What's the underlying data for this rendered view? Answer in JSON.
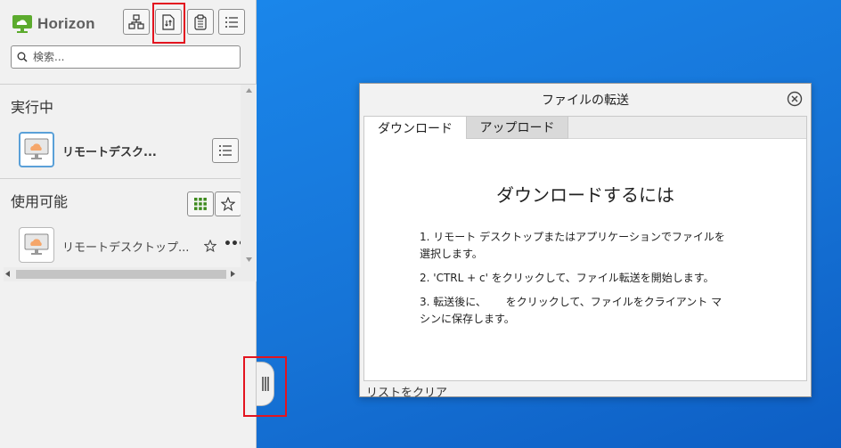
{
  "app": {
    "name": "Horizon"
  },
  "search": {
    "placeholder": "検索..."
  },
  "sections": {
    "running": {
      "title": "実行中",
      "item_label": "リモートデスク..."
    },
    "available": {
      "title": "使用可能",
      "item_label": "リモートデスクトップ..."
    }
  },
  "dialog": {
    "title": "ファイルの転送",
    "tabs": [
      "ダウンロード",
      "アップロード"
    ],
    "heading": "ダウンロードするには",
    "steps": [
      "1. リモート デスクトップまたはアプリケーションでファイルを",
      "選択します。",
      "2. 'CTRL + c' をクリックして、ファイル転送を開始します。",
      "3. 転送後に、　　 をクリックして、ファイルをクライアント マ",
      "シンに保存します。"
    ],
    "footer": "リストをクリア"
  },
  "colors": {
    "highlight": "#e3141f",
    "desktop": "#1a7fe0",
    "brand_green": "#5cab2e",
    "cloud_orange": "#f5a66a"
  }
}
